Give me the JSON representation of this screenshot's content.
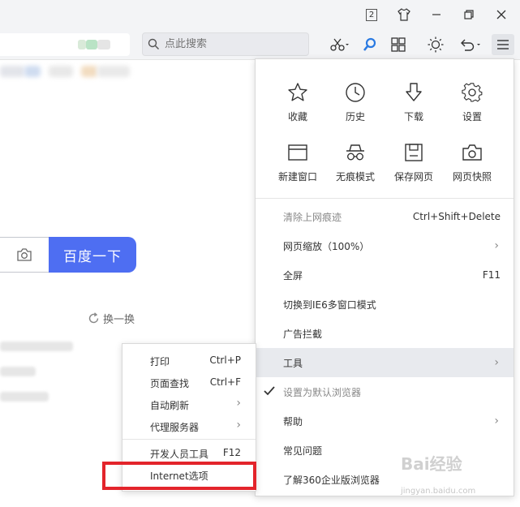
{
  "titlebar": {
    "tab_count": "2",
    "icons": [
      "tab-count-icon",
      "skin-shirt-icon",
      "minimize-icon",
      "restore-icon",
      "close-icon"
    ]
  },
  "toolbar": {
    "search_placeholder": "点此搜索",
    "icons": [
      "scissors-icon",
      "search-magnifier-icon",
      "apps-grid-icon",
      "brightness-icon",
      "undo-icon",
      "menu-icon"
    ]
  },
  "page": {
    "search_button": "百度一下",
    "refresh_label": "换一换"
  },
  "menu": {
    "grid": [
      {
        "label": "收藏",
        "icon": "star-icon"
      },
      {
        "label": "历史",
        "icon": "clock-icon"
      },
      {
        "label": "下载",
        "icon": "download-icon"
      },
      {
        "label": "设置",
        "icon": "gear-icon"
      },
      {
        "label": "新建窗口",
        "icon": "new-window-icon"
      },
      {
        "label": "无痕模式",
        "icon": "incognito-icon"
      },
      {
        "label": "保存网页",
        "icon": "save-icon"
      },
      {
        "label": "网页快照",
        "icon": "camera-icon"
      }
    ],
    "items": [
      {
        "label": "清除上网痕迹",
        "shortcut": "Ctrl+Shift+Delete"
      },
      {
        "label": "网页缩放（100%）",
        "arrow": "›"
      },
      {
        "label": "全屏",
        "shortcut": "F11"
      },
      {
        "label": "切换到IE6多窗口模式"
      },
      {
        "label": "广告拦截"
      },
      {
        "label": "工具",
        "arrow": "›"
      },
      {
        "label": "设置为默认浏览器"
      },
      {
        "label": "帮助",
        "arrow": "›"
      },
      {
        "label": "常见问题"
      },
      {
        "label": "了解360企业版浏览器"
      }
    ]
  },
  "submenu": {
    "items": [
      {
        "label": "打印",
        "shortcut": "Ctrl+P"
      },
      {
        "label": "页面查找",
        "shortcut": "Ctrl+F"
      },
      {
        "label": "自动刷新",
        "arrow": "›"
      },
      {
        "label": "代理服务器",
        "arrow": "›"
      },
      {
        "label": "开发人员工具",
        "shortcut": "F12"
      },
      {
        "label": "Internet选项"
      }
    ]
  },
  "watermark": {
    "brand": "Bai经验",
    "url": "jingyan.baidu.com"
  },
  "colors": {
    "accent": "#4e6ef2",
    "highlight_box": "#e3242b",
    "menu_hover": "#e8eaee"
  }
}
